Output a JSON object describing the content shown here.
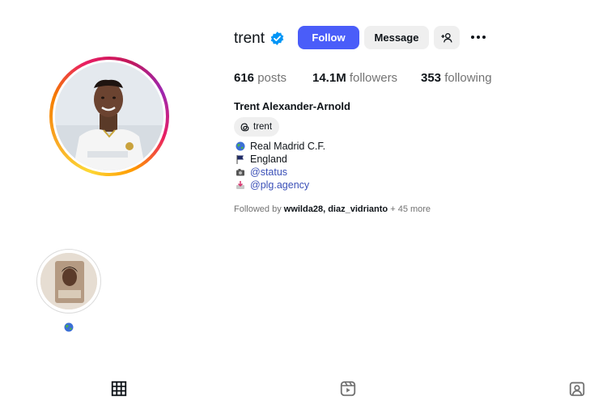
{
  "profile": {
    "username": "trent",
    "full_name": "Trent Alexander-Arnold",
    "verified": true
  },
  "actions": {
    "follow_label": "Follow",
    "message_label": "Message",
    "add_user_icon": "person-add-icon",
    "more_icon": "more-horizontal-icon"
  },
  "stats": {
    "posts_count": "616",
    "posts_label": "posts",
    "followers_count": "14.1M",
    "followers_label": "followers",
    "following_count": "353",
    "following_label": "following"
  },
  "threads": {
    "label": "trent",
    "icon": "threads-icon"
  },
  "bio": [
    {
      "icon": "globe-icon",
      "text": "Real Madrid C.F."
    },
    {
      "icon": "flag-icon",
      "text": "England"
    },
    {
      "icon": "camera-icon",
      "text": "@status"
    },
    {
      "icon": "inbox-tray-icon",
      "text": "@plg.agency"
    }
  ],
  "followed_by": {
    "prefix": "Followed by",
    "user1": "wwilda28",
    "user2": "diaz_vidrianto",
    "suffix": "+ 45 more"
  },
  "highlight": {
    "label_icon": "globe-icon"
  },
  "tabs": [
    "grid-icon",
    "reels-icon",
    "tagged-icon"
  ],
  "colors": {
    "accent": "#4a5df9",
    "link": "#3a4fb7",
    "muted": "#737373",
    "button_bg": "#efefef"
  }
}
